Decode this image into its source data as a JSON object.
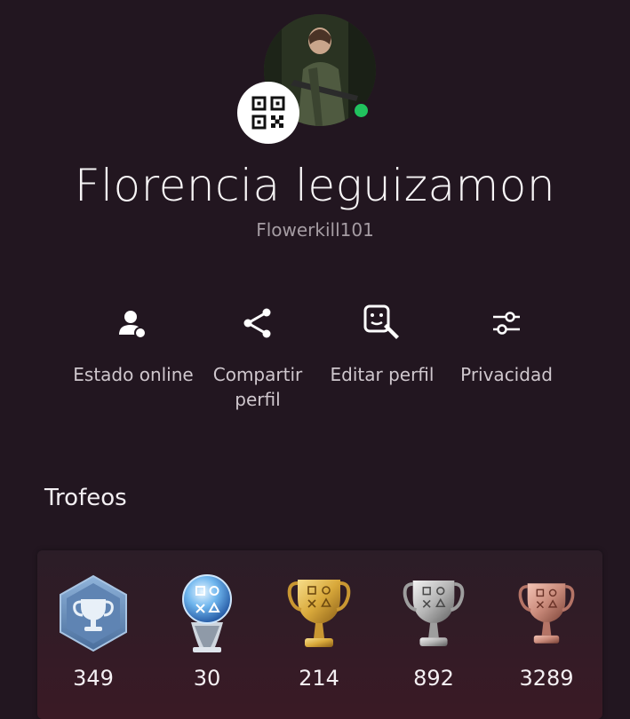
{
  "profile": {
    "display_name": "Florencia leguizamon",
    "online_id": "Flowerkill101"
  },
  "actions": [
    {
      "label": "Estado online",
      "icon": "online-status-icon"
    },
    {
      "label": "Compartir perfil",
      "icon": "share-icon"
    },
    {
      "label": "Editar perfil",
      "icon": "edit-profile-icon"
    },
    {
      "label": "Privacidad",
      "icon": "privacy-sliders-icon"
    }
  ],
  "trophies": {
    "title": "Trofeos",
    "items": [
      {
        "type": "level",
        "count": "349"
      },
      {
        "type": "platinum",
        "count": "30"
      },
      {
        "type": "gold",
        "count": "214"
      },
      {
        "type": "silver",
        "count": "892"
      },
      {
        "type": "bronze",
        "count": "3289"
      }
    ]
  },
  "colors": {
    "background": "#221620",
    "online": "#21c25e",
    "gold": "#d9a93b",
    "silver": "#b5b5b5",
    "bronze": "#c98a7a"
  }
}
